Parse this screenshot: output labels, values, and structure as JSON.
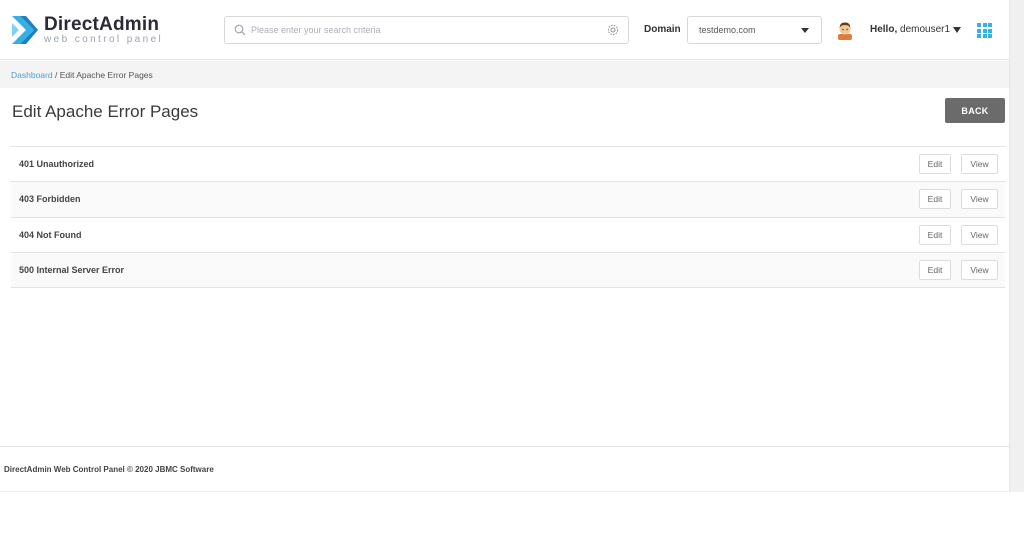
{
  "header": {
    "logo_name": "DirectAdmin",
    "logo_tagline": "web control panel",
    "search_placeholder": "Please enter your search criteria",
    "domain_label": "Domain",
    "domain_value": "testdemo.com",
    "hello_prefix": "Hello,",
    "username": "demouser1"
  },
  "breadcrumb": {
    "home": "Dashboard",
    "separator": " / ",
    "current": "Edit Apache Error Pages"
  },
  "page": {
    "title": "Edit Apache Error Pages",
    "back_label": "BACK"
  },
  "error_pages": [
    {
      "label": "401 Unauthorized",
      "edit": "Edit",
      "view": "View"
    },
    {
      "label": "403 Forbidden",
      "edit": "Edit",
      "view": "View"
    },
    {
      "label": "404 Not Found",
      "edit": "Edit",
      "view": "View"
    },
    {
      "label": "500 Internal Server Error",
      "edit": "Edit",
      "view": "View"
    }
  ],
  "footer": {
    "text": "DirectAdmin Web Control Panel © 2020 JBMC Software"
  },
  "colors": {
    "accent": "#33b4e8",
    "link": "#4a9fd8",
    "back_button": "#6b6b6b"
  },
  "icons": [
    "logo-icon",
    "search-icon",
    "gear-icon",
    "chevron-down-icon",
    "avatar-icon",
    "apps-grid-icon"
  ]
}
